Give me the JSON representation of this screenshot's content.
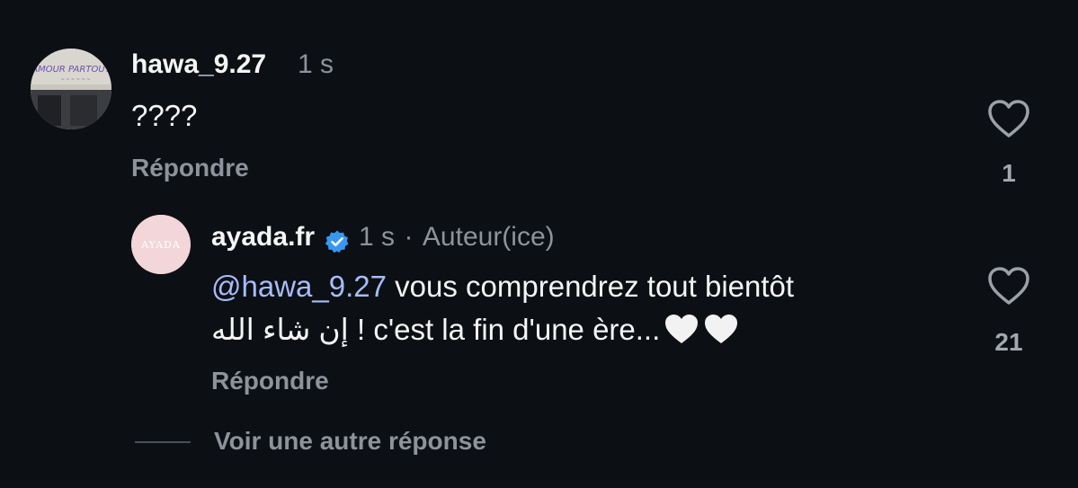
{
  "comments": [
    {
      "username": "hawa_9.27",
      "time": "1 s",
      "text": "????",
      "reply_label": "Répondre",
      "like_count": "1",
      "avatar_sign_text": "AMOUR PARTOUT"
    },
    {
      "username": "ayada.fr",
      "time": "1 s",
      "separator": "·",
      "author_badge": "Auteur(ice)",
      "mention": "@hawa_9.27",
      "text_line1": " vous comprendrez tout bientôt",
      "text_line2": "إن شاء الله ! c'est la fin d'une ère...",
      "reply_label": "Répondre",
      "like_count": "21",
      "avatar_logo_text": "AYADA"
    }
  ],
  "more_replies_label": "Voir une autre réponse",
  "colors": {
    "background": "#0c0f14",
    "primary_text": "#f5f5f5",
    "secondary_text": "#8e939b",
    "mention": "#a6bdfa",
    "verified": "#3897f0"
  }
}
